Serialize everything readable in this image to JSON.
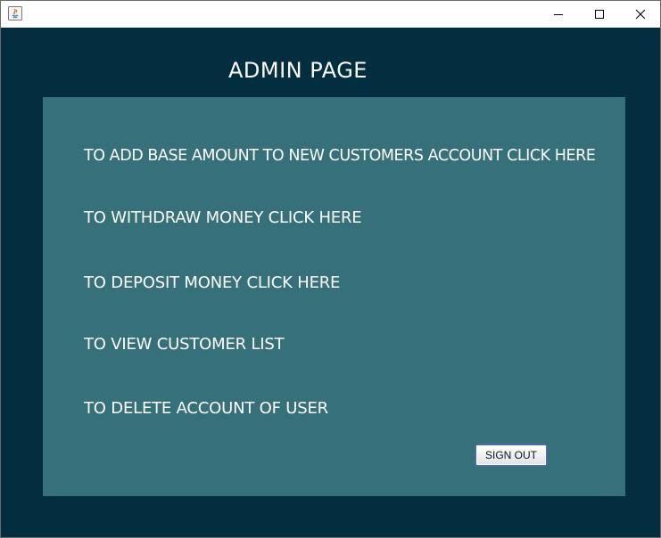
{
  "window": {
    "controls": {
      "minimize": "minimize-icon",
      "maximize": "maximize-icon",
      "close": "close-icon"
    }
  },
  "colors": {
    "background": "#032e3f",
    "panel": "#35707b",
    "text": "#ffffff"
  },
  "page": {
    "title": "ADMIN PAGE"
  },
  "actions": [
    {
      "label": "TO ADD BASE AMOUNT TO NEW CUSTOMERS ACCOUNT CLICK HERE"
    },
    {
      "label": "TO WITHDRAW MONEY CLICK HERE"
    },
    {
      "label": "TO DEPOSIT MONEY CLICK HERE"
    },
    {
      "label": "TO VIEW CUSTOMER LIST"
    },
    {
      "label": "TO DELETE ACCOUNT OF USER"
    }
  ],
  "signout": {
    "label": "SIGN OUT"
  }
}
